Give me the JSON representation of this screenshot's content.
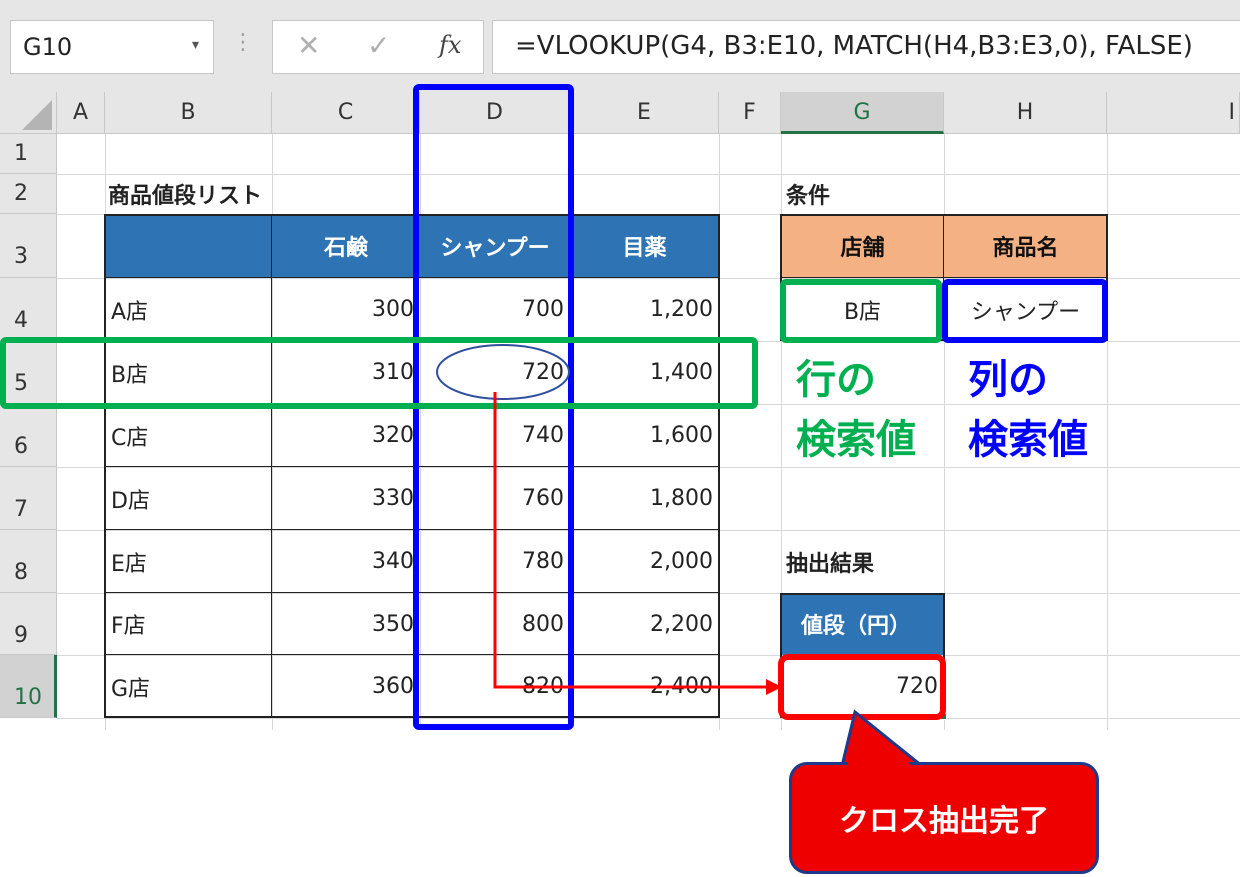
{
  "formula_bar": {
    "name_box": "G10",
    "formula": "=VLOOKUP(G4, B3:E10, MATCH(H4,B3:E3,0), FALSE)"
  },
  "columns": [
    "A",
    "B",
    "C",
    "D",
    "E",
    "F",
    "G",
    "H",
    "I"
  ],
  "rows": [
    "1",
    "2",
    "3",
    "4",
    "5",
    "6",
    "7",
    "8",
    "9",
    "10"
  ],
  "price_table": {
    "title": "商品値段リスト",
    "headers": [
      "",
      "石鹸",
      "シャンプー",
      "目薬"
    ],
    "rows": [
      {
        "store": "A店",
        "soap": "300",
        "shampoo": "700",
        "eyedrops": "1,200"
      },
      {
        "store": "B店",
        "soap": "310",
        "shampoo": "720",
        "eyedrops": "1,400"
      },
      {
        "store": "C店",
        "soap": "320",
        "shampoo": "740",
        "eyedrops": "1,600"
      },
      {
        "store": "D店",
        "soap": "330",
        "shampoo": "760",
        "eyedrops": "1,800"
      },
      {
        "store": "E店",
        "soap": "340",
        "shampoo": "780",
        "eyedrops": "2,000"
      },
      {
        "store": "F店",
        "soap": "350",
        "shampoo": "800",
        "eyedrops": "2,200"
      },
      {
        "store": "G店",
        "soap": "360",
        "shampoo": "820",
        "eyedrops": "2,400"
      }
    ]
  },
  "conditions": {
    "title": "条件",
    "store_header": "店舗",
    "product_header": "商品名",
    "store_value": "B店",
    "product_value": "シャンプー"
  },
  "result": {
    "title": "抽出結果",
    "header": "値段（円）",
    "value": "720"
  },
  "annotations": {
    "row_lookup": "行の\n検索値",
    "col_lookup": "列の\n検索値",
    "callout": "クロス抽出完了"
  },
  "colors": {
    "row_highlight": "#00b050",
    "col_highlight": "#0000ff",
    "result_highlight": "#ff0000",
    "table_header": "#2e74b5",
    "condition_header": "#f4b183",
    "excel_green": "#217346"
  }
}
